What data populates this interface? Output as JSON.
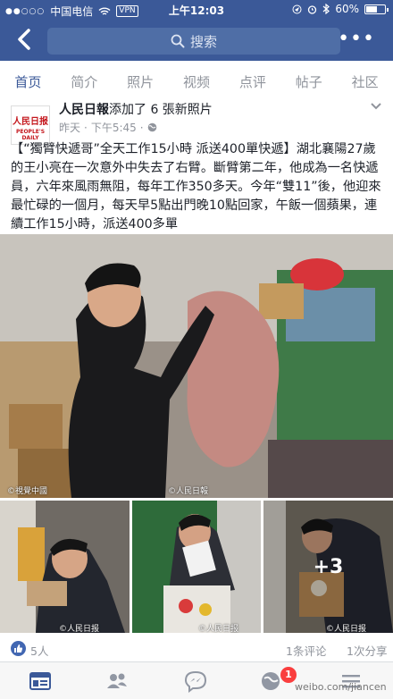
{
  "status_bar": {
    "signal": "●●○○○",
    "carrier": "中国电信",
    "vpn": "VPN",
    "time": "上午12:03",
    "battery": "60%",
    "battery_level": 0.6
  },
  "nav": {
    "search_placeholder": "搜索"
  },
  "tabs": [
    {
      "label": "首页",
      "active": true
    },
    {
      "label": "简介"
    },
    {
      "label": "照片"
    },
    {
      "label": "视频"
    },
    {
      "label": "点评"
    },
    {
      "label": "帖子"
    },
    {
      "label": "社区"
    }
  ],
  "post": {
    "author": "人民日報",
    "action": "添加了 6 張新照片",
    "avatar_text_cn": "人民日报",
    "avatar_text_en": "PEOPLE'S DAILY",
    "time_day": "昨天",
    "time_clock": "下午5:45",
    "text": "【“獨臂快遞哥”全天工作15小時 派送400單快遞】湖北襄陽27歲的王小亮在一次意外中失去了右臂。斷臂第二年，他成為一名快遞員，六年來風雨無阻，每年工作350多天。今年“雙11”後，他迎來最忙碌的一個月，每天早5點出門晚10點回家，午飯一個蘋果，連續工作15小時，派送400多單",
    "photo_credit_left": "©視覺中國",
    "photo_credit_right": "©人民日報",
    "small_credit": "©人民日报",
    "more_photos": "+3"
  },
  "reactions": {
    "likes": "5人",
    "comments": "1条评论",
    "shares": "1次分享"
  },
  "bottom_nav": {
    "notifications_badge": "1",
    "watermark": "weibo.com/jiancen"
  },
  "colors": {
    "brand": "#3b5998",
    "badge": "#fa3e3e"
  }
}
